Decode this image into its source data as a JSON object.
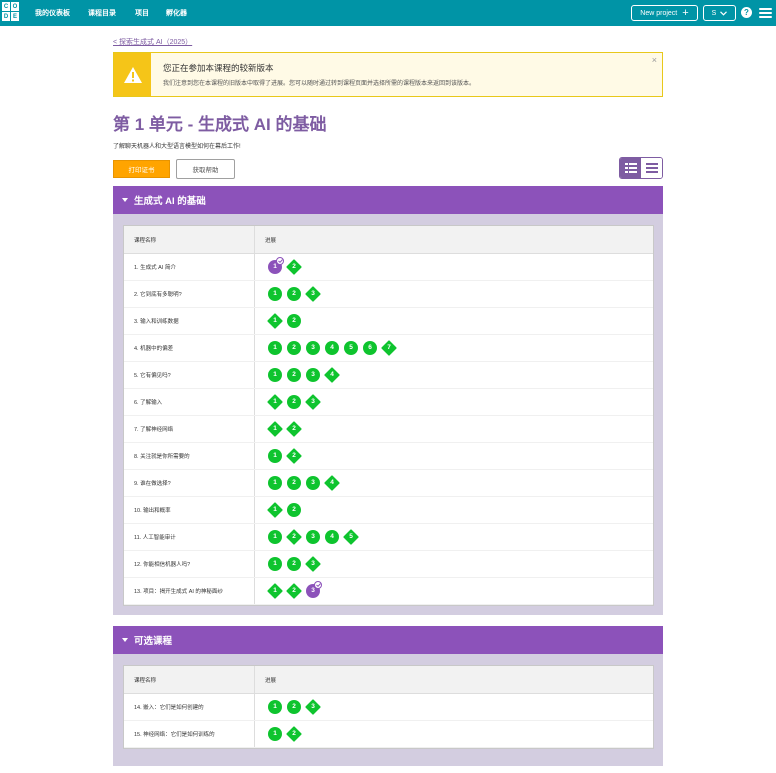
{
  "logo": {
    "letters": [
      "C",
      "O",
      "D",
      "E"
    ]
  },
  "nav": {
    "dashboard": "我的仪表板",
    "catalog": "课程目录",
    "projects": "项目",
    "incubator": "孵化器",
    "new_project": "New project",
    "user_initial": "S",
    "help": "?"
  },
  "breadcrumb": "< 探索生成式 AI（2025）",
  "notice": {
    "title": "您正在参加本课程的较新版本",
    "body": "我们注意到您在本课程的旧版本中取得了进展。您可以随时通过转到课程页面并选择所需的课程版本来返回到该版本。",
    "close": "×"
  },
  "unit": {
    "title": "第 1 单元 - 生成式 AI 的基础",
    "description": "了解聊天机器人和大型语言模型如何在幕后工作!"
  },
  "buttons": {
    "print": "打印证书",
    "help": "获取帮助"
  },
  "colors": {
    "header": "#0094a6",
    "purple": "#8c52ba",
    "green": "#0ec42e",
    "orange": "#ffa400"
  },
  "sections": [
    {
      "title": "生成式 AI 的基础",
      "col_lesson": "课程名称",
      "col_progress": "进展",
      "rows": [
        {
          "name": "1. 生成式 AI 简介",
          "levels": [
            {
              "n": "1",
              "shape": "circle-assessment",
              "check": true
            },
            {
              "n": "2",
              "shape": "diamond"
            }
          ]
        },
        {
          "name": "2. 它到底有多聪明?",
          "levels": [
            {
              "n": "1",
              "shape": "circle"
            },
            {
              "n": "2",
              "shape": "circle"
            },
            {
              "n": "3",
              "shape": "diamond"
            }
          ]
        },
        {
          "name": "3. 输入和训练数据",
          "levels": [
            {
              "n": "1",
              "shape": "diamond"
            },
            {
              "n": "2",
              "shape": "circle"
            }
          ]
        },
        {
          "name": "4. 机器中的偏差",
          "levels": [
            {
              "n": "1",
              "shape": "circle"
            },
            {
              "n": "2",
              "shape": "circle"
            },
            {
              "n": "3",
              "shape": "circle"
            },
            {
              "n": "4",
              "shape": "circle"
            },
            {
              "n": "5",
              "shape": "circle"
            },
            {
              "n": "6",
              "shape": "circle"
            },
            {
              "n": "7",
              "shape": "diamond"
            }
          ]
        },
        {
          "name": "5. 它有偏见吗?",
          "levels": [
            {
              "n": "1",
              "shape": "circle"
            },
            {
              "n": "2",
              "shape": "circle"
            },
            {
              "n": "3",
              "shape": "circle"
            },
            {
              "n": "4",
              "shape": "diamond"
            }
          ]
        },
        {
          "name": "6. 了解输入",
          "levels": [
            {
              "n": "1",
              "shape": "diamond"
            },
            {
              "n": "2",
              "shape": "circle"
            },
            {
              "n": "3",
              "shape": "diamond"
            }
          ]
        },
        {
          "name": "7. 了解神经网络",
          "levels": [
            {
              "n": "1",
              "shape": "diamond"
            },
            {
              "n": "2",
              "shape": "diamond"
            }
          ]
        },
        {
          "name": "8. 关注就是你所需要的",
          "levels": [
            {
              "n": "1",
              "shape": "circle"
            },
            {
              "n": "2",
              "shape": "diamond"
            }
          ]
        },
        {
          "name": "9. 谁在做选择?",
          "levels": [
            {
              "n": "1",
              "shape": "circle"
            },
            {
              "n": "2",
              "shape": "circle"
            },
            {
              "n": "3",
              "shape": "circle"
            },
            {
              "n": "4",
              "shape": "diamond"
            }
          ]
        },
        {
          "name": "10. 输出和概率",
          "levels": [
            {
              "n": "1",
              "shape": "diamond"
            },
            {
              "n": "2",
              "shape": "circle"
            }
          ]
        },
        {
          "name": "11. 人工智能审计",
          "levels": [
            {
              "n": "1",
              "shape": "circle"
            },
            {
              "n": "2",
              "shape": "diamond"
            },
            {
              "n": "3",
              "shape": "circle"
            },
            {
              "n": "4",
              "shape": "circle"
            },
            {
              "n": "5",
              "shape": "diamond"
            }
          ]
        },
        {
          "name": "12. 你能相信机器人吗?",
          "levels": [
            {
              "n": "1",
              "shape": "circle"
            },
            {
              "n": "2",
              "shape": "circle"
            },
            {
              "n": "3",
              "shape": "diamond"
            }
          ]
        },
        {
          "name": "13. 项目：揭开生成式 AI 的神秘面纱",
          "levels": [
            {
              "n": "1",
              "shape": "diamond"
            },
            {
              "n": "2",
              "shape": "diamond"
            },
            {
              "n": "3",
              "shape": "circle-assessment",
              "check": true
            }
          ]
        }
      ]
    },
    {
      "title": "可选课程",
      "col_lesson": "课程名称",
      "col_progress": "进展",
      "rows": [
        {
          "name": "14. 嵌入：它们是如何创建的",
          "levels": [
            {
              "n": "1",
              "shape": "circle"
            },
            {
              "n": "2",
              "shape": "circle"
            },
            {
              "n": "3",
              "shape": "diamond"
            }
          ]
        },
        {
          "name": "15. 神经网络：它们是如何训练的",
          "levels": [
            {
              "n": "1",
              "shape": "circle"
            },
            {
              "n": "2",
              "shape": "diamond"
            }
          ]
        }
      ]
    }
  ]
}
